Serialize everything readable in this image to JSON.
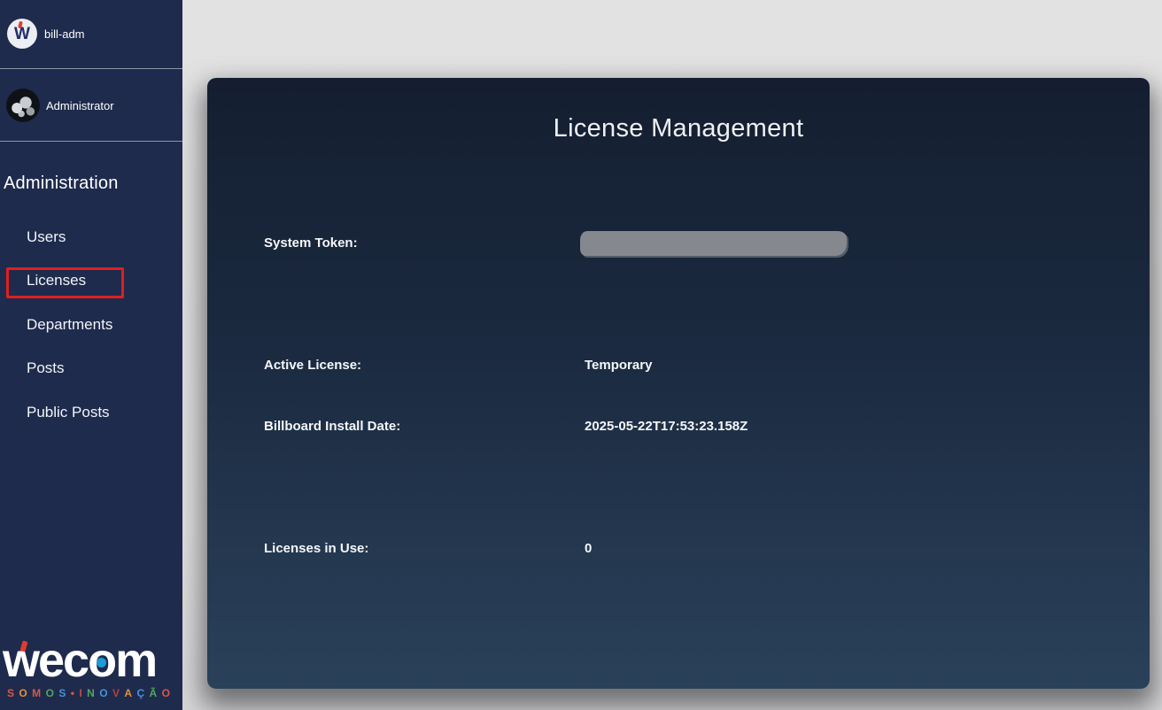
{
  "sidebar": {
    "account": {
      "logo_letter": "W",
      "name": "bill-adm"
    },
    "user": {
      "name": "Administrator"
    },
    "section_title": "Administration",
    "items": [
      {
        "label": "Users",
        "active": false
      },
      {
        "label": "Licenses",
        "active": true
      },
      {
        "label": "Departments",
        "active": false
      },
      {
        "label": "Posts",
        "active": false
      },
      {
        "label": "Public Posts",
        "active": false
      }
    ],
    "logo": {
      "word_parts": {
        "prefix": "wec",
        "o": "o",
        "suffix": "m"
      },
      "word": "wecom",
      "tagline": "SOMOS•INOVAÇÃO",
      "tagline_letters": [
        {
          "ch": "S",
          "color": "#d85948"
        },
        {
          "ch": "O",
          "color": "#df8f3e"
        },
        {
          "ch": "M",
          "color": "#d85948"
        },
        {
          "ch": "O",
          "color": "#57a35c"
        },
        {
          "ch": "S",
          "color": "#4a90d9"
        },
        {
          "ch": "•",
          "color": "#d85948"
        },
        {
          "ch": "I",
          "color": "#c24b44"
        },
        {
          "ch": "N",
          "color": "#57a35c"
        },
        {
          "ch": "O",
          "color": "#4a90d9"
        },
        {
          "ch": "V",
          "color": "#b5403c"
        },
        {
          "ch": "A",
          "color": "#df8f3e"
        },
        {
          "ch": "Ç",
          "color": "#4a90d9"
        },
        {
          "ch": "Ã",
          "color": "#57a35c"
        },
        {
          "ch": "O",
          "color": "#d85948"
        }
      ]
    }
  },
  "main": {
    "card": {
      "title": "License Management",
      "fields": [
        {
          "label": "System Token:",
          "value": "",
          "redacted": true
        },
        {
          "label": "Active License:",
          "value": "Temporary"
        },
        {
          "label": "Billboard Install Date:",
          "value": "2025-05-22T17:53:23.158Z"
        },
        {
          "label": "Licenses in Use:",
          "value": "0"
        }
      ]
    }
  },
  "colors": {
    "sidebar_bg": "#1e2b4d",
    "card_gradient_top": "#141e30",
    "card_gradient_bottom": "#2a415a",
    "page_bg": "#e0e0e2",
    "highlight_red": "#e01f1f",
    "redacted_gray": "#85898f",
    "logo_blue": "#1d9cd8",
    "logo_red": "#e03c2e",
    "text_white": "#ffffff"
  }
}
